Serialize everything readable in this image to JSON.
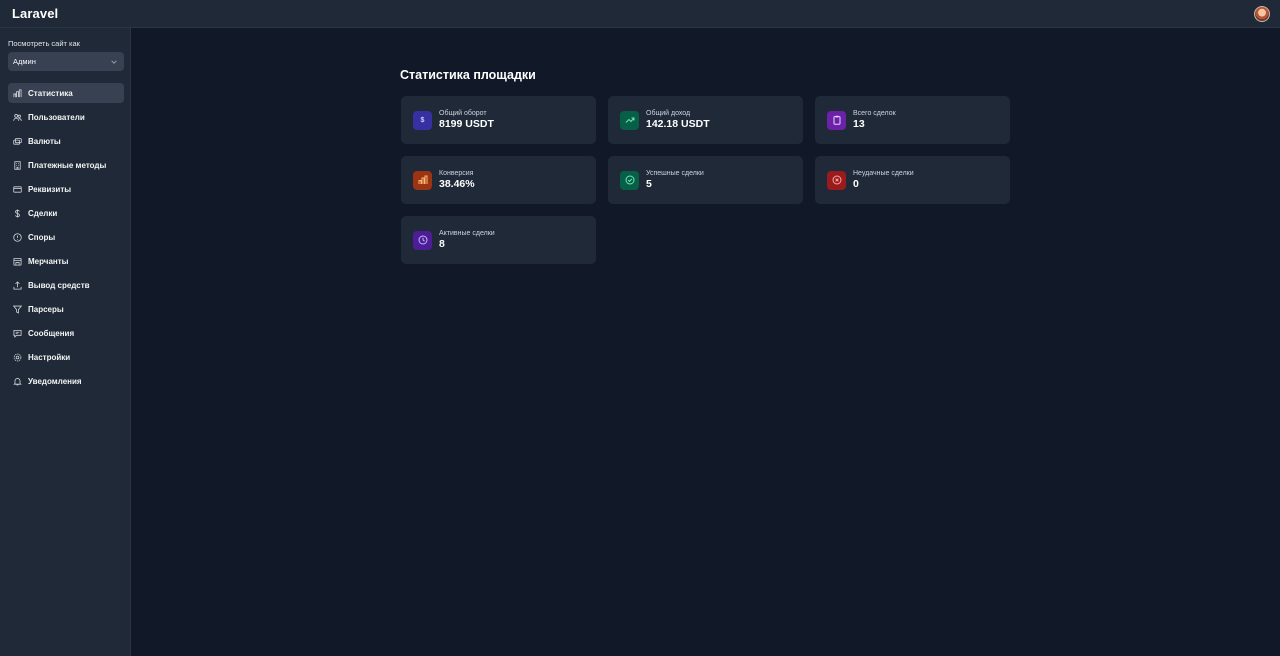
{
  "app": {
    "title": "Laravel"
  },
  "sidebar": {
    "view_as_label": "Посмотреть сайт как",
    "view_as_value": "Админ",
    "items": [
      {
        "label": "Статистика",
        "icon": "chart-bar-icon",
        "active": true
      },
      {
        "label": "Пользователи",
        "icon": "users-icon"
      },
      {
        "label": "Валюты",
        "icon": "currency-icon"
      },
      {
        "label": "Платежные методы",
        "icon": "building-icon"
      },
      {
        "label": "Реквизиты",
        "icon": "credit-card-icon"
      },
      {
        "label": "Сделки",
        "icon": "dollar-icon"
      },
      {
        "label": "Споры",
        "icon": "info-circle-icon"
      },
      {
        "label": "Мерчанты",
        "icon": "store-icon"
      },
      {
        "label": "Вывод средств",
        "icon": "upload-icon"
      },
      {
        "label": "Парсеры",
        "icon": "filter-icon"
      },
      {
        "label": "Сообщения",
        "icon": "chat-icon"
      },
      {
        "label": "Настройки",
        "icon": "gear-icon"
      },
      {
        "label": "Уведомления",
        "icon": "bell-icon"
      }
    ]
  },
  "main": {
    "title": "Статистика площадки",
    "cards": [
      {
        "label": "Общий оборот",
        "value": "8199 USDT",
        "icon": "dollar-icon",
        "color": "#3730a3"
      },
      {
        "label": "Общий доход",
        "value": "142.18 USDT",
        "icon": "trending-up-icon",
        "color": "#065f46"
      },
      {
        "label": "Всего сделок",
        "value": "13",
        "icon": "clipboard-icon",
        "color": "#6b21a8"
      },
      {
        "label": "Конверсия",
        "value": "38.46%",
        "icon": "chart-bar-icon",
        "color": "#9a3412"
      },
      {
        "label": "Успешные сделки",
        "value": "5",
        "icon": "check-circle-icon",
        "color": "#065f46"
      },
      {
        "label": "Неудачные сделки",
        "value": "0",
        "icon": "x-circle-icon",
        "color": "#991b1b"
      },
      {
        "label": "Активные сделки",
        "value": "8",
        "icon": "clock-icon",
        "color": "#4c1d95"
      }
    ]
  }
}
